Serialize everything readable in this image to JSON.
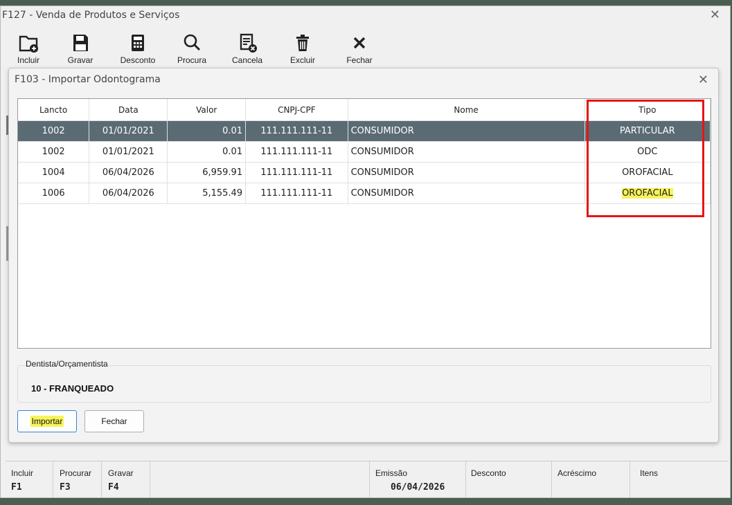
{
  "main_window": {
    "title": "F127 - Venda de Produtos e Serviços",
    "close": "✕"
  },
  "toolbar": [
    {
      "label": "Incluir",
      "icon": "folder-plus-icon"
    },
    {
      "label": "Gravar",
      "icon": "save-icon"
    },
    {
      "label": "Desconto",
      "icon": "calculator-icon"
    },
    {
      "label": "Procura",
      "icon": "search-icon"
    },
    {
      "label": "Cancela",
      "icon": "cancel-doc-icon"
    },
    {
      "label": "Excluir",
      "icon": "trash-icon"
    },
    {
      "label": "Fechar",
      "icon": "close-icon"
    }
  ],
  "dialog": {
    "title": "F103 - Importar Odontograma",
    "close": "✕",
    "columns": [
      "Lancto",
      "Data",
      "Valor",
      "CNPJ-CPF",
      "Nome",
      "Tipo"
    ],
    "rows": [
      {
        "lancto": "1002",
        "data": "01/01/2021",
        "valor": "0.01",
        "cnpj": "111.111.111-11",
        "nome": "CONSUMIDOR",
        "tipo": "PARTICULAR",
        "selected": true
      },
      {
        "lancto": "1002",
        "data": "01/01/2021",
        "valor": "0.01",
        "cnpj": "111.111.111-11",
        "nome": "CONSUMIDOR",
        "tipo": "ODC"
      },
      {
        "lancto": "1004",
        "data": "06/04/2026",
        "valor": "6,959.91",
        "cnpj": "111.111.111-11",
        "nome": "CONSUMIDOR",
        "tipo": "OROFACIAL"
      },
      {
        "lancto": "1006",
        "data": "06/04/2026",
        "valor": "5,155.49",
        "cnpj": "111.111.111-11",
        "nome": "CONSUMIDOR",
        "tipo": "OROFACIAL",
        "highlight": true
      }
    ],
    "dentista_label": "Dentista/Orçamentista",
    "dentista_value": "10 - FRANQUEADO",
    "import_button": "Importar",
    "close_button": "Fechar"
  },
  "status_bar": {
    "shortcuts": [
      {
        "label": "Incluir",
        "key": "F1"
      },
      {
        "label": "Procurar",
        "key": "F3"
      },
      {
        "label": "Gravar",
        "key": "F4"
      }
    ],
    "emissao_label": "Emissão",
    "emissao_value": "06/04/2026",
    "desconto_label": "Desconto",
    "acrescimo_label": "Acréscimo",
    "itens_label": "Itens"
  },
  "colors": {
    "selected_row": "#5b6b73",
    "highlight": "#f7f35a",
    "annotation": "#e81414"
  }
}
